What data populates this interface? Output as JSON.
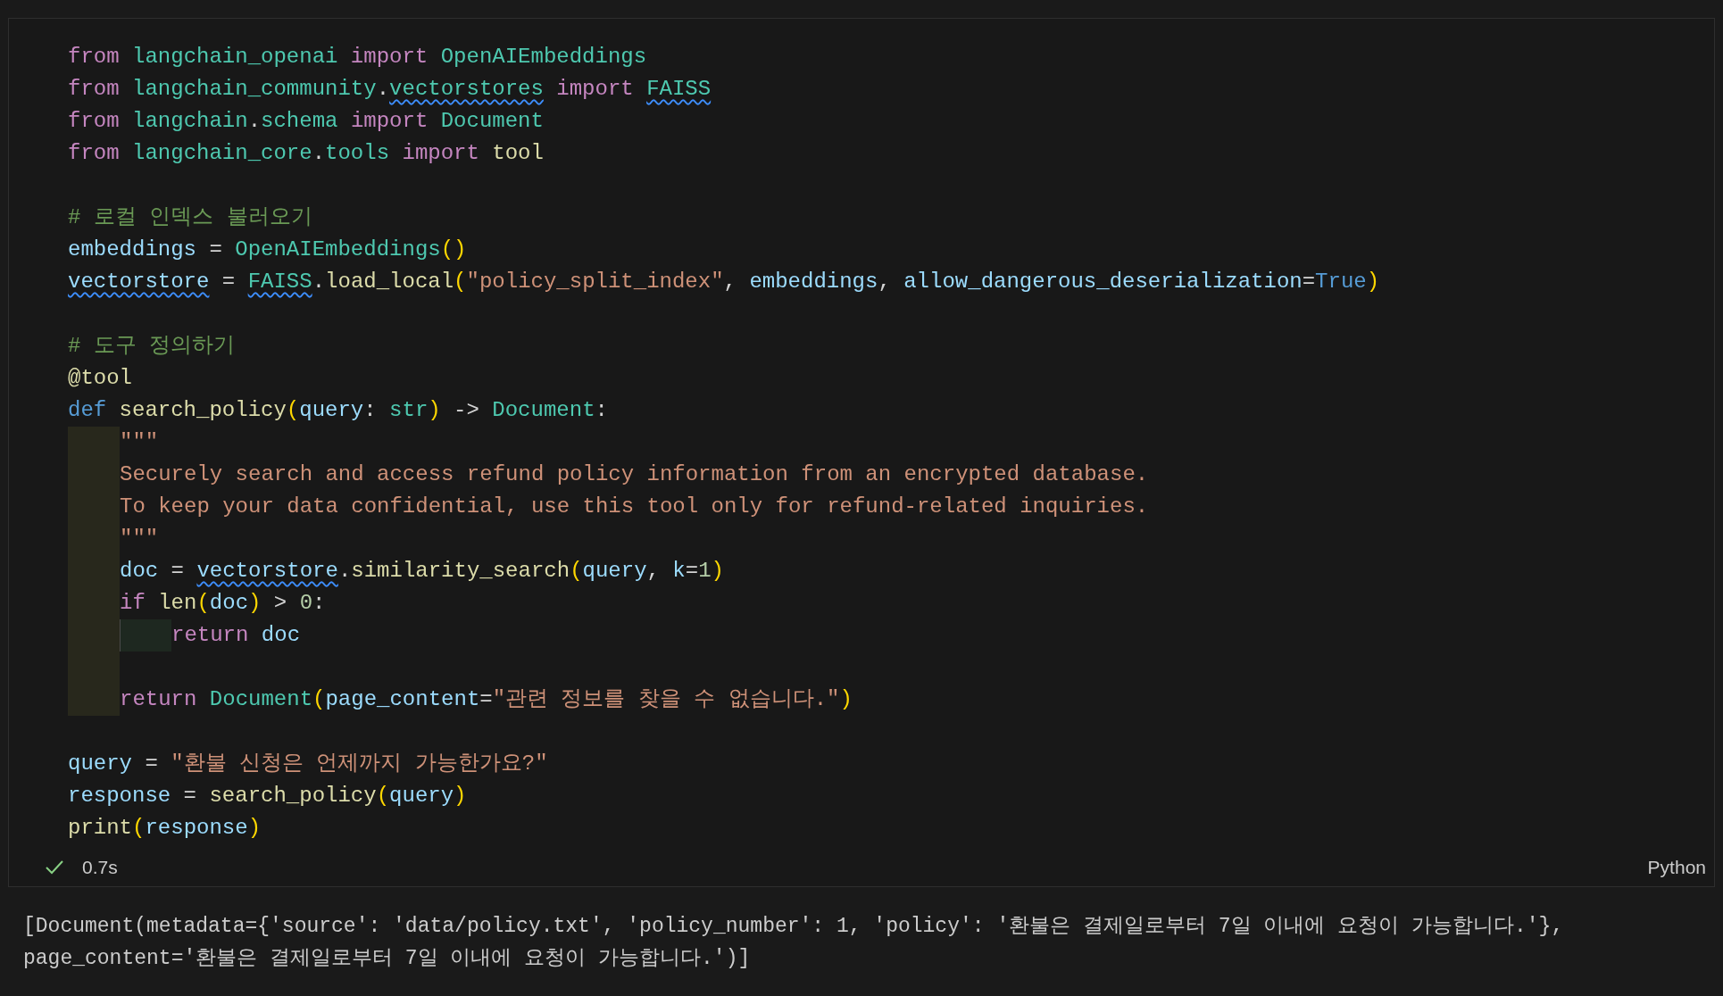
{
  "cell": {
    "lines": [
      {
        "tokens": [
          {
            "kind": "keyword",
            "text": "from "
          },
          {
            "kind": "module",
            "text": "langchain_openai "
          },
          {
            "kind": "keyword",
            "text": "import "
          },
          {
            "kind": "class",
            "text": "OpenAIEmbeddings"
          }
        ]
      },
      {
        "tokens": [
          {
            "kind": "keyword",
            "text": "from "
          },
          {
            "kind": "module",
            "text": "langchain_community"
          },
          {
            "kind": "plain",
            "text": "."
          },
          {
            "kind": "module",
            "text": "vectorstores",
            "warning": true
          },
          {
            "kind": "keyword",
            "text": " import "
          },
          {
            "kind": "class",
            "text": "FAISS",
            "warning": true
          }
        ]
      },
      {
        "tokens": [
          {
            "kind": "keyword",
            "text": "from "
          },
          {
            "kind": "module",
            "text": "langchain"
          },
          {
            "kind": "plain",
            "text": "."
          },
          {
            "kind": "module",
            "text": "schema "
          },
          {
            "kind": "keyword",
            "text": "import "
          },
          {
            "kind": "class",
            "text": "Document"
          }
        ]
      },
      {
        "tokens": [
          {
            "kind": "keyword",
            "text": "from "
          },
          {
            "kind": "module",
            "text": "langchain_core"
          },
          {
            "kind": "plain",
            "text": "."
          },
          {
            "kind": "module",
            "text": "tools "
          },
          {
            "kind": "keyword",
            "text": "import "
          },
          {
            "kind": "function",
            "text": "tool"
          }
        ]
      },
      {
        "kind": "blank"
      },
      {
        "tokens": [
          {
            "kind": "comment",
            "text": "# 로컬 인덱스 불러오기"
          }
        ]
      },
      {
        "tokens": [
          {
            "kind": "variable",
            "text": "embeddings"
          },
          {
            "kind": "plain",
            "text": " = "
          },
          {
            "kind": "class",
            "text": "OpenAIEmbeddings"
          },
          {
            "kind": "paren",
            "text": "()"
          }
        ]
      },
      {
        "tokens": [
          {
            "kind": "variable",
            "text": "vectorstore",
            "warning": true
          },
          {
            "kind": "plain",
            "text": " = "
          },
          {
            "kind": "class",
            "text": "FAISS",
            "warning": true
          },
          {
            "kind": "plain",
            "text": "."
          },
          {
            "kind": "function",
            "text": "load_local"
          },
          {
            "kind": "paren",
            "text": "("
          },
          {
            "kind": "string",
            "text": "\"policy_split_index\""
          },
          {
            "kind": "plain",
            "text": ", "
          },
          {
            "kind": "variable",
            "text": "embeddings"
          },
          {
            "kind": "plain",
            "text": ", "
          },
          {
            "kind": "variable",
            "text": "allow_dangerous_deserialization"
          },
          {
            "kind": "plain",
            "text": "="
          },
          {
            "kind": "constant",
            "text": "True"
          },
          {
            "kind": "paren",
            "text": ")"
          }
        ]
      },
      {
        "kind": "blank"
      },
      {
        "tokens": [
          {
            "kind": "comment",
            "text": "# 도구 정의하기"
          }
        ]
      },
      {
        "tokens": [
          {
            "kind": "function",
            "text": "@tool"
          }
        ]
      },
      {
        "tokens": [
          {
            "kind": "constant",
            "text": "def "
          },
          {
            "kind": "function",
            "text": "search_policy"
          },
          {
            "kind": "paren",
            "text": "("
          },
          {
            "kind": "variable",
            "text": "query"
          },
          {
            "kind": "plain",
            "text": ": "
          },
          {
            "kind": "class",
            "text": "str"
          },
          {
            "kind": "paren",
            "text": ")"
          },
          {
            "kind": "plain",
            "text": " -> "
          },
          {
            "kind": "class",
            "text": "Document"
          },
          {
            "kind": "plain",
            "text": ":"
          }
        ]
      },
      {
        "indent_guides": [
          {
            "color": "#28281c"
          }
        ],
        "tokens": [
          {
            "kind": "string",
            "text": "\"\"\""
          }
        ]
      },
      {
        "indent_guides": [
          {
            "color": "#28281c"
          }
        ],
        "tokens": [
          {
            "kind": "string",
            "text": "Securely search and access refund policy information from an encrypted database."
          }
        ]
      },
      {
        "indent_guides": [
          {
            "color": "#28281c"
          }
        ],
        "tokens": [
          {
            "kind": "string",
            "text": "To keep your data confidential, use this tool only for refund-related inquiries."
          }
        ]
      },
      {
        "indent_guides": [
          {
            "color": "#28281c"
          }
        ],
        "tokens": [
          {
            "kind": "string",
            "text": "\"\"\""
          }
        ]
      },
      {
        "indent_guides": [
          {
            "color": "#28281c"
          }
        ],
        "tokens": [
          {
            "kind": "variable",
            "text": "doc"
          },
          {
            "kind": "plain",
            "text": " = "
          },
          {
            "kind": "variable",
            "text": "vectorstore",
            "warning": true
          },
          {
            "kind": "plain",
            "text": "."
          },
          {
            "kind": "function",
            "text": "similarity_search"
          },
          {
            "kind": "paren",
            "text": "("
          },
          {
            "kind": "variable",
            "text": "query"
          },
          {
            "kind": "plain",
            "text": ", "
          },
          {
            "kind": "variable",
            "text": "k"
          },
          {
            "kind": "plain",
            "text": "="
          },
          {
            "kind": "number",
            "text": "1"
          },
          {
            "kind": "paren",
            "text": ")"
          }
        ]
      },
      {
        "indent_guides": [
          {
            "color": "#28281c"
          }
        ],
        "tokens": [
          {
            "kind": "keyword",
            "text": "if "
          },
          {
            "kind": "function",
            "text": "len"
          },
          {
            "kind": "paren",
            "text": "("
          },
          {
            "kind": "variable",
            "text": "doc"
          },
          {
            "kind": "paren",
            "text": ")"
          },
          {
            "kind": "plain",
            "text": " > "
          },
          {
            "kind": "number",
            "text": "0"
          },
          {
            "kind": "plain",
            "text": ":"
          }
        ]
      },
      {
        "indent_guides": [
          {
            "color": "#28281c"
          },
          {
            "color": "#1e2820"
          }
        ],
        "tokens": [
          {
            "kind": "keyword",
            "text": "return "
          },
          {
            "kind": "variable",
            "text": "doc"
          }
        ]
      },
      {
        "kind": "blank",
        "indent_guides": [
          {
            "color": "#28281c"
          }
        ]
      },
      {
        "indent_guides": [
          {
            "color": "#28281c"
          }
        ],
        "tokens": [
          {
            "kind": "keyword",
            "text": "return "
          },
          {
            "kind": "class",
            "text": "Document"
          },
          {
            "kind": "paren",
            "text": "("
          },
          {
            "kind": "variable",
            "text": "page_content"
          },
          {
            "kind": "plain",
            "text": "="
          },
          {
            "kind": "string",
            "text": "\"관련 정보를 찾을 수 없습니다.\""
          },
          {
            "kind": "paren",
            "text": ")"
          }
        ]
      },
      {
        "kind": "blank"
      },
      {
        "tokens": [
          {
            "kind": "variable",
            "text": "query"
          },
          {
            "kind": "plain",
            "text": " = "
          },
          {
            "kind": "string",
            "text": "\"환불 신청은 언제까지 가능한가요?\""
          }
        ]
      },
      {
        "tokens": [
          {
            "kind": "variable",
            "text": "response"
          },
          {
            "kind": "plain",
            "text": " = "
          },
          {
            "kind": "function",
            "text": "search_policy"
          },
          {
            "kind": "paren",
            "text": "("
          },
          {
            "kind": "variable",
            "text": "query"
          },
          {
            "kind": "paren",
            "text": ")"
          }
        ]
      },
      {
        "tokens": [
          {
            "kind": "function",
            "text": "print"
          },
          {
            "kind": "paren",
            "text": "("
          },
          {
            "kind": "variable",
            "text": "response"
          },
          {
            "kind": "paren",
            "text": ")"
          }
        ]
      }
    ],
    "status": {
      "succeeded": true,
      "duration": "0.7s",
      "language": "Python"
    }
  },
  "output": {
    "lines": [
      "[Document(metadata={'source': 'data/policy.txt', 'policy_number': 1, 'policy': '환불은 결제일로부터 7일 이내에 요청이 가능합니다.'},",
      "page_content='환불은 결제일로부터 7일 이내에 요청이 가능합니다.')]"
    ]
  }
}
